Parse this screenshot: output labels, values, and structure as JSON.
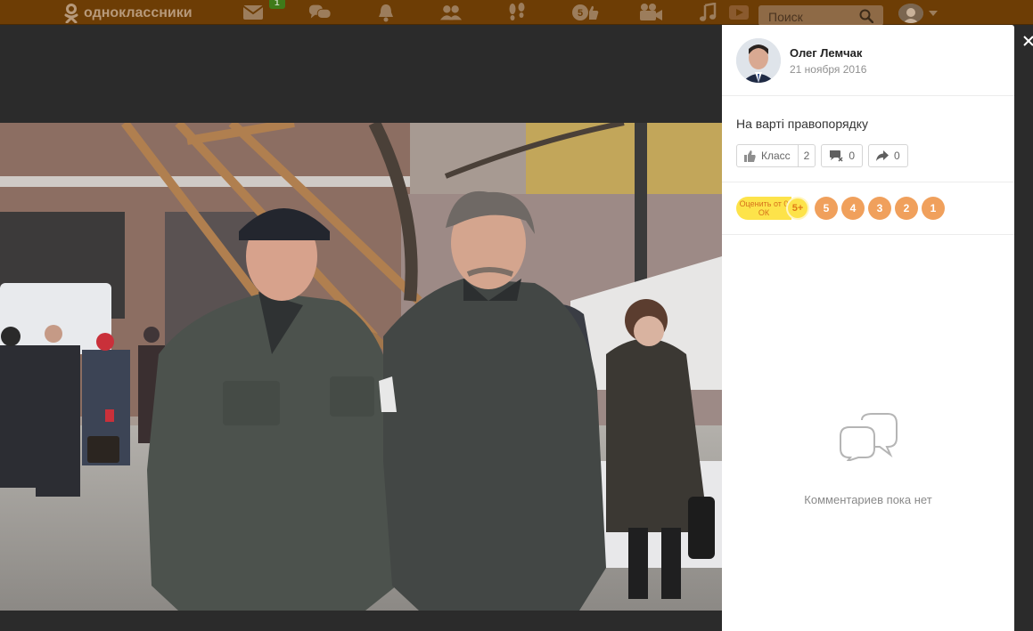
{
  "topbar": {
    "logo_text": "одноклассники",
    "messages_badge": "1",
    "notifications_badge": "5",
    "search_placeholder": "Поиск",
    "icons": [
      "logo-icon",
      "envelope-icon",
      "discussions-icon",
      "bell-icon",
      "friends-icon",
      "footprints-icon",
      "events-icon",
      "video-icon",
      "music-icon",
      "video-play-icon",
      "search-icon",
      "avatar-icon",
      "chevron-down-icon"
    ]
  },
  "post": {
    "author_name": "Олег Лемчак",
    "date": "21 ноября 2016",
    "caption": "На варті правопорядку",
    "like_label": "Класс",
    "like_count": "2",
    "comment_count": "0",
    "share_count": "0"
  },
  "rating": {
    "label": "Оценить от 0 ОК",
    "plus_label": "5+",
    "options": [
      "5",
      "4",
      "3",
      "2",
      "1"
    ]
  },
  "comments": {
    "empty_text": "Комментариев пока нет"
  },
  "colors": {
    "topbar": "#6d3d05",
    "panel": "#ffffff",
    "rating_yellow": "#fde34a",
    "rating_orange": "#f0a05c",
    "backdrop": "#2b2b2b"
  }
}
